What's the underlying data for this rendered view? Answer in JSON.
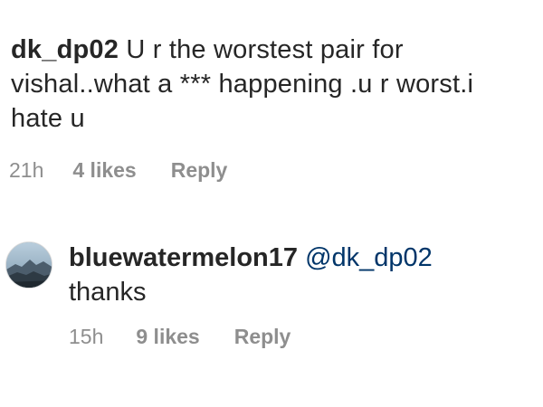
{
  "comment": {
    "username": "dk_dp02",
    "text": "U r the worstest pair for vishal..what a *** happening .u r worst.i hate u",
    "time": "21h",
    "likes": "4 likes",
    "reply_label": "Reply"
  },
  "reply": {
    "username": "bluewatermelon17",
    "mention": "@dk_dp02",
    "text": "thanks",
    "time": "15h",
    "likes": "9 likes",
    "reply_label": "Reply",
    "avatar_icon": "avatar-landscape-photo"
  },
  "colors": {
    "text": "#262626",
    "meta": "#8e8e8e",
    "mention": "#003569"
  }
}
